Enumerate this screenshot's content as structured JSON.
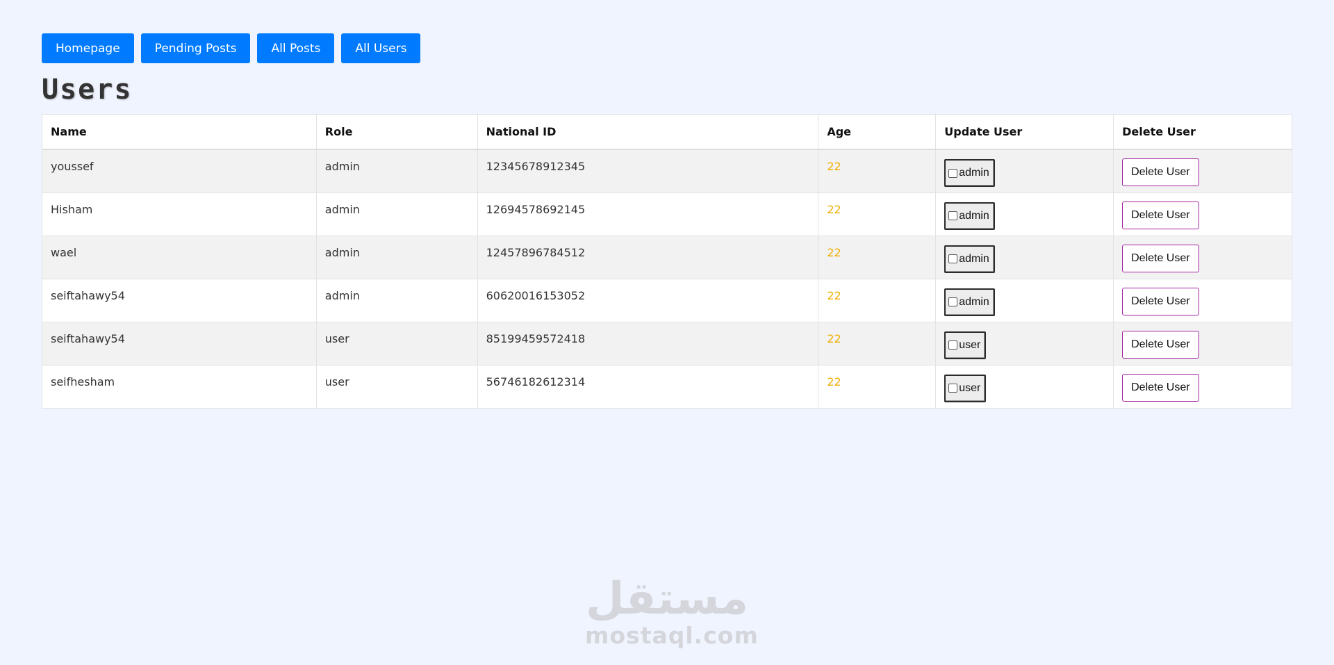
{
  "nav": {
    "buttons": [
      {
        "label": "Homepage"
      },
      {
        "label": "Pending Posts"
      },
      {
        "label": "All Posts"
      },
      {
        "label": "All Users"
      }
    ]
  },
  "page": {
    "title": "Users"
  },
  "table": {
    "headers": [
      "Name",
      "Role",
      "National ID",
      "Age",
      "Update User",
      "Delete User"
    ],
    "rows": [
      {
        "name": "youssef",
        "role": "admin",
        "national_id": "12345678912345",
        "age": "22",
        "update_label": "admin",
        "delete_label": "Delete User"
      },
      {
        "name": "Hisham",
        "role": "admin",
        "national_id": "12694578692145",
        "age": "22",
        "update_label": "admin",
        "delete_label": "Delete User"
      },
      {
        "name": "wael",
        "role": "admin",
        "national_id": "12457896784512",
        "age": "22",
        "update_label": "admin",
        "delete_label": "Delete User"
      },
      {
        "name": "seiftahawy54",
        "role": "admin",
        "national_id": "60620016153052",
        "age": "22",
        "update_label": "admin",
        "delete_label": "Delete User"
      },
      {
        "name": "seiftahawy54",
        "role": "user",
        "national_id": "85199459572418",
        "age": "22",
        "update_label": "user",
        "delete_label": "Delete User"
      },
      {
        "name": "seifhesham",
        "role": "user",
        "national_id": "56746182612314",
        "age": "22",
        "update_label": "user",
        "delete_label": "Delete User"
      }
    ]
  },
  "watermark": {
    "logo_text": "مستقل",
    "site": "mostaql.com"
  },
  "colors": {
    "page_background": "#f0f4fe",
    "nav_button": "#007bff",
    "age_text": "#f0ad00",
    "delete_border": "#a020a0"
  }
}
